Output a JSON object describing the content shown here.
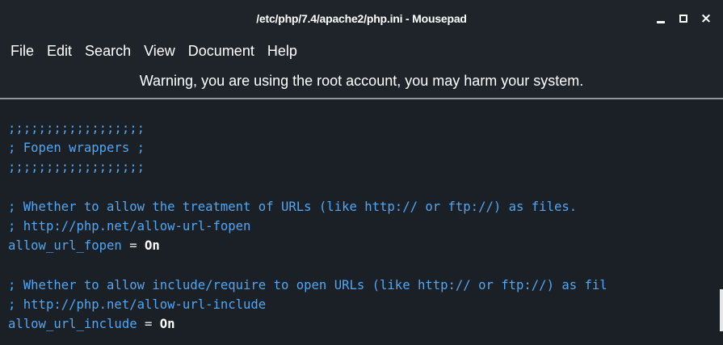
{
  "window": {
    "title": "/etc/php/7.4/apache2/php.ini - Mousepad",
    "controls": [
      "minimize-icon",
      "maximize-icon",
      "close-icon"
    ],
    "close_glyph": "×"
  },
  "menubar": {
    "items": [
      "File",
      "Edit",
      "Search",
      "View",
      "Document",
      "Help"
    ]
  },
  "infobar": {
    "warning": "Warning, you are using the root account, you may harm your system."
  },
  "editor": {
    "lines": {
      "l1": ";;;;;;;;;;;;;;;;;;",
      "l2": "; Fopen wrappers ;",
      "l3": ";;;;;;;;;;;;;;;;;;",
      "l4": "",
      "l5": "; Whether to allow the treatment of URLs (like http:// or ftp://) as files.",
      "l6": "; http://php.net/allow-url-fopen",
      "l7_key": "allow_url_fopen",
      "l7_op": " = ",
      "l7_val": "On",
      "l8": "",
      "l9": "; Whether to allow include/require to open URLs (like http:// or ftp://) as fil",
      "l10": "; http://php.net/allow-url-include",
      "l11_key": "allow_url_include",
      "l11_op": " = ",
      "l11_val": "On"
    }
  },
  "colors": {
    "background": "#1b1f26",
    "comment": "#50a7f4",
    "text": "#ffffff",
    "separator": "#8f969e"
  }
}
